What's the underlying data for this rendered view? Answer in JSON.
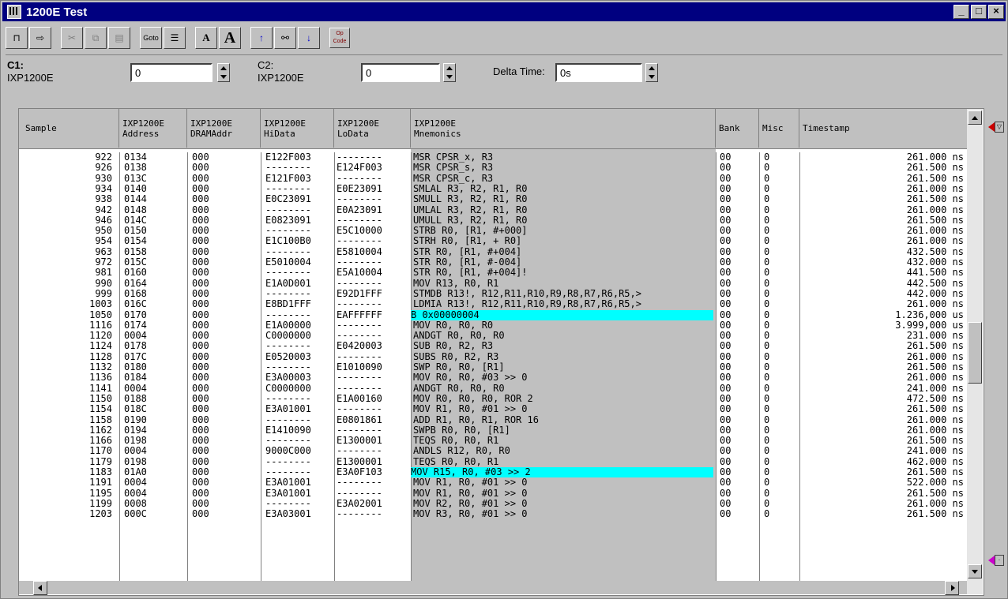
{
  "window": {
    "title": "1200E Test",
    "min_label": "_",
    "max_label": "□",
    "close_label": "×"
  },
  "toolbar": {
    "items": [
      "cursor-add",
      "cursor-move",
      "cut",
      "copy",
      "paste",
      "goto",
      "properties",
      "font-small",
      "font-large",
      "search-up",
      "find",
      "search-down",
      "opcode"
    ],
    "goto_label": "Goto",
    "font_small_label": "A",
    "font_large_label": "A",
    "opcode_label": "Op Code"
  },
  "cursors": {
    "c1_label": "C1:",
    "c1_sub": "IXP1200E",
    "c1_value": "0",
    "c2_label": "C2:",
    "c2_sub": "IXP1200E",
    "c2_value": "0",
    "delta_label": "Delta Time:",
    "delta_value": "0s"
  },
  "table": {
    "headers": [
      {
        "l1": "",
        "l2": "Sample"
      },
      {
        "l1": "IXP1200E",
        "l2": "Address"
      },
      {
        "l1": "IXP1200E",
        "l2": "DRAMAddr"
      },
      {
        "l1": "IXP1200E",
        "l2": "HiData"
      },
      {
        "l1": "IXP1200E",
        "l2": "LoData"
      },
      {
        "l1": "IXP1200E",
        "l2": "Mnemonics"
      },
      {
        "l1": "",
        "l2": "Bank"
      },
      {
        "l1": "",
        "l2": "Misc"
      },
      {
        "l1": "",
        "l2": "Timestamp"
      }
    ],
    "rows": [
      [
        "922",
        "0134",
        "000",
        "E122F003",
        "--------",
        "MSR CPSR_x, R3",
        "00",
        "0",
        "261.000 ns"
      ],
      [
        "926",
        "0138",
        "000",
        "--------",
        "E124F003",
        "MSR CPSR_s, R3",
        "00",
        "0",
        "261.500 ns"
      ],
      [
        "930",
        "013C",
        "000",
        "E121F003",
        "--------",
        "MSR CPSR_c, R3",
        "00",
        "0",
        "261.500 ns"
      ],
      [
        "934",
        "0140",
        "000",
        "--------",
        "E0E23091",
        "SMLAL R3, R2, R1, R0",
        "00",
        "0",
        "261.000 ns"
      ],
      [
        "938",
        "0144",
        "000",
        "E0C23091",
        "--------",
        "SMULL R3, R2, R1, R0",
        "00",
        "0",
        "261.500 ns"
      ],
      [
        "942",
        "0148",
        "000",
        "--------",
        "E0A23091",
        "UMLAL R3, R2, R1, R0",
        "00",
        "0",
        "261.000 ns"
      ],
      [
        "946",
        "014C",
        "000",
        "E0823091",
        "--------",
        "UMULL R3, R2, R1, R0",
        "00",
        "0",
        "261.500 ns"
      ],
      [
        "950",
        "0150",
        "000",
        "--------",
        "E5C10000",
        "STRB R0, [R1, #+000]",
        "00",
        "0",
        "261.000 ns"
      ],
      [
        "954",
        "0154",
        "000",
        "E1C100B0",
        "--------",
        "STRH R0, [R1, + R0]",
        "00",
        "0",
        "261.000 ns"
      ],
      [
        "963",
        "0158",
        "000",
        "--------",
        "E5810004",
        "STR R0, [R1, #+004]",
        "00",
        "0",
        "432.500 ns"
      ],
      [
        "972",
        "015C",
        "000",
        "E5010004",
        "--------",
        "STR R0, [R1, #-004]",
        "00",
        "0",
        "432.000 ns"
      ],
      [
        "981",
        "0160",
        "000",
        "--------",
        "E5A10004",
        "STR R0, [R1, #+004]!",
        "00",
        "0",
        "441.500 ns"
      ],
      [
        "990",
        "0164",
        "000",
        "E1A0D001",
        "--------",
        "MOV R13, R0, R1",
        "00",
        "0",
        "442.500 ns"
      ],
      [
        "999",
        "0168",
        "000",
        "--------",
        "E92D1FFF",
        "STMDB R13!, R12,R11,R10,R9,R8,R7,R6,R5,>",
        "00",
        "0",
        "442.000 ns"
      ],
      [
        "1003",
        "016C",
        "000",
        "E8BD1FFF",
        "--------",
        "LDMIA R13!, R12,R11,R10,R9,R8,R7,R6,R5,>",
        "00",
        "0",
        "261.000 ns"
      ],
      [
        "1050",
        "0170",
        "000",
        "--------",
        "EAFFFFFF",
        "B 0x00000004",
        "00",
        "0",
        "1.236,000 us"
      ],
      [
        "1116",
        "0174",
        "000",
        "E1A00000",
        "--------",
        "MOV R0, R0, R0",
        "00",
        "0",
        "3.999,000 us"
      ],
      [
        "1120",
        "0004",
        "000",
        "C0000000",
        "--------",
        "ANDGT R0, R0, R0",
        "00",
        "0",
        "231.000 ns"
      ],
      [
        "1124",
        "0178",
        "000",
        "--------",
        "E0420003",
        "SUB R0, R2, R3",
        "00",
        "0",
        "261.500 ns"
      ],
      [
        "1128",
        "017C",
        "000",
        "E0520003",
        "--------",
        "SUBS R0, R2, R3",
        "00",
        "0",
        "261.000 ns"
      ],
      [
        "1132",
        "0180",
        "000",
        "--------",
        "E1010090",
        "SWP R0, R0, [R1]",
        "00",
        "0",
        "261.500 ns"
      ],
      [
        "1136",
        "0184",
        "000",
        "E3A00003",
        "--------",
        "MOV R0, R0, #03 >> 0",
        "00",
        "0",
        "261.000 ns"
      ],
      [
        "1141",
        "0004",
        "000",
        "C0000000",
        "--------",
        "ANDGT R0, R0, R0",
        "00",
        "0",
        "241.000 ns"
      ],
      [
        "1150",
        "0188",
        "000",
        "--------",
        "E1A00160",
        "MOV R0, R0, R0, ROR 2",
        "00",
        "0",
        "472.500 ns"
      ],
      [
        "1154",
        "018C",
        "000",
        "E3A01001",
        "--------",
        "MOV R1, R0, #01 >> 0",
        "00",
        "0",
        "261.500 ns"
      ],
      [
        "1158",
        "0190",
        "000",
        "--------",
        "E0801861",
        "ADD R1, R0, R1, ROR 16",
        "00",
        "0",
        "261.000 ns"
      ],
      [
        "1162",
        "0194",
        "000",
        "E1410090",
        "--------",
        "SWPB R0, R0, [R1]",
        "00",
        "0",
        "261.000 ns"
      ],
      [
        "1166",
        "0198",
        "000",
        "--------",
        "E1300001",
        "TEQS R0, R0, R1",
        "00",
        "0",
        "261.500 ns"
      ],
      [
        "1170",
        "0004",
        "000",
        "9000C000",
        "--------",
        "ANDLS R12, R0, R0",
        "00",
        "0",
        "241.000 ns"
      ],
      [
        "1179",
        "0198",
        "000",
        "--------",
        "E1300001",
        "TEQS R0, R0, R1",
        "00",
        "0",
        "462.000 ns"
      ],
      [
        "1183",
        "01A0",
        "000",
        "--------",
        "E3A0F103",
        "MOV R15, R0, #03 >> 2",
        "00",
        "0",
        "261.500 ns"
      ],
      [
        "1191",
        "0004",
        "000",
        "E3A01001",
        "--------",
        "MOV R1, R0, #01 >> 0",
        "00",
        "0",
        "522.000 ns"
      ],
      [
        "1195",
        "0004",
        "000",
        "E3A01001",
        "--------",
        "MOV R1, R0, #01 >> 0",
        "00",
        "0",
        "261.500 ns"
      ],
      [
        "1199",
        "0008",
        "000",
        "--------",
        "E3A02001",
        "MOV R2, R0, #01 >> 0",
        "00",
        "0",
        "261.000 ns"
      ],
      [
        "1203",
        "000C",
        "000",
        "E3A03001",
        "--------",
        "MOV R3, R0, #01 >> 0",
        "00",
        "0",
        "261.500 ns"
      ]
    ],
    "highlighted_rows": [
      15,
      30
    ],
    "highlight_color": "#00ffff"
  },
  "colors": {
    "titlebar": "#000080",
    "marker_c1": "#cc0000",
    "marker_c2": "#cc00cc"
  }
}
